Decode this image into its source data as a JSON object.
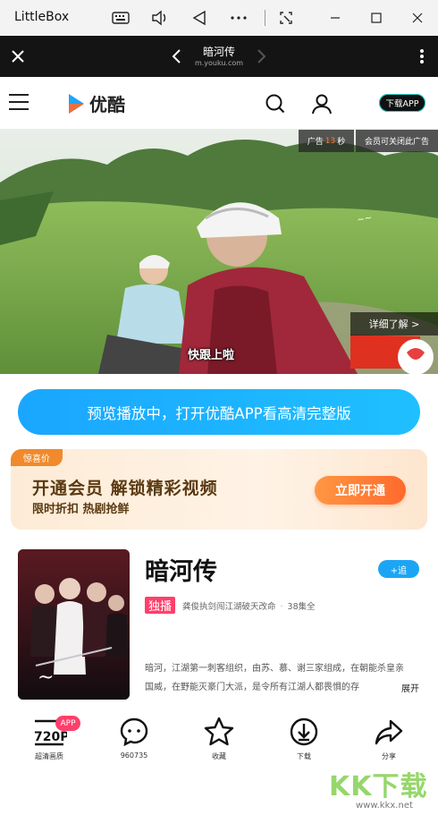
{
  "titlebar": {
    "app_name": "LittleBox",
    "icons": [
      "keyboard-icon",
      "volume-icon",
      "back-triangle-icon",
      "more-dots-icon",
      "screenshot-icon"
    ],
    "window_buttons": [
      "minimize-icon",
      "maximize-icon",
      "close-icon"
    ]
  },
  "browser_nav": {
    "title": "暗河传",
    "url": "m.youku.com"
  },
  "site_header": {
    "logo_text": "优酷",
    "download_app": "下载APP"
  },
  "ad": {
    "label": "广告",
    "countdown": "13",
    "seconds_unit": "秒",
    "vip_close": "会员可关闭此广告",
    "detail": "详细了解 >",
    "caption": "快跟上啦"
  },
  "preview_button": "预览播放中，打开优酷APP看高清完整版",
  "vip_banner": {
    "tag": "惊喜价",
    "title": "开通会员  解锁精彩视频",
    "subtitle": "限时折扣 热剧抢鲜",
    "button": "立即开通"
  },
  "show": {
    "title": "暗河传",
    "follow": "+追",
    "exclusive": "独播",
    "tag1": "龚俊执剑闯江湖破天改命",
    "tag2": "38集全",
    "description_line1": "暗河，江湖第一刺客组织，由苏、慕、谢三家组成，在朝能杀皇亲",
    "description_line2": "国威，在野能灭豪门大派，是令所有江湖人都畏惧的存",
    "expand": "展开"
  },
  "actions": [
    {
      "label": "超清画质",
      "icon": "720p-icon"
    },
    {
      "label": "960735",
      "icon": "comment-icon"
    },
    {
      "label": "收藏",
      "icon": "star-icon"
    },
    {
      "label": "下载",
      "icon": "download-icon"
    },
    {
      "label": "分享",
      "icon": "share-icon"
    }
  ],
  "app_badge": "APP",
  "watermark": {
    "text": "KK下载",
    "url": "www.kkx.net"
  }
}
